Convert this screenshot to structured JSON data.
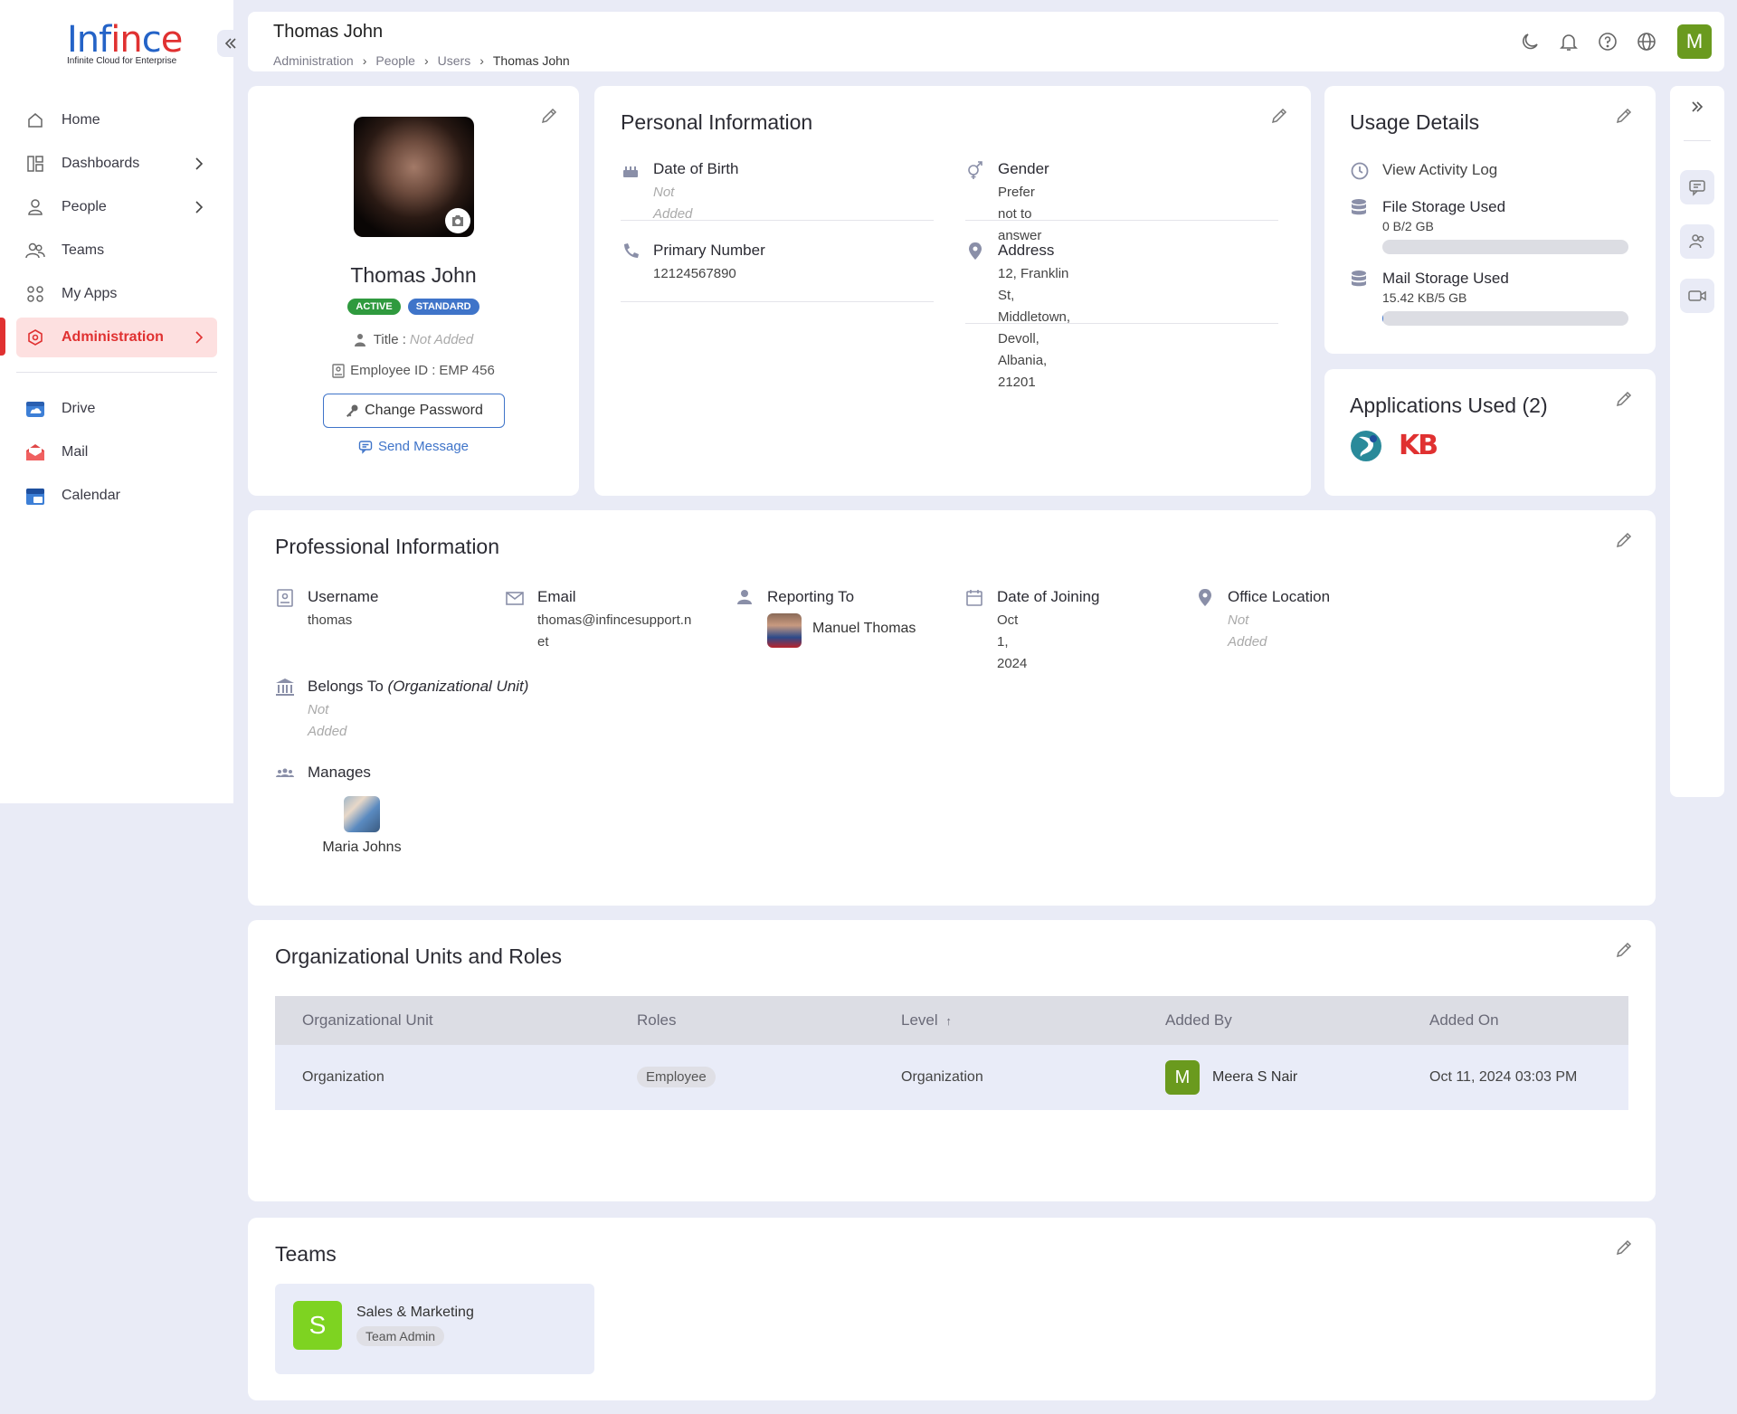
{
  "app": {
    "logo_text_blue": "Inf",
    "logo_text_red": "in",
    "logo_text_blue2": "c",
    "logo_text_red2": "e",
    "logo_tagline": "Infinite Cloud for Enterprise"
  },
  "sidebar": {
    "items": [
      {
        "label": "Home",
        "icon": "home-icon"
      },
      {
        "label": "Dashboards",
        "icon": "dashboard-icon"
      },
      {
        "label": "People",
        "icon": "person-icon"
      },
      {
        "label": "Teams",
        "icon": "teams-icon"
      },
      {
        "label": "My Apps",
        "icon": "apps-icon"
      },
      {
        "label": "Administration",
        "icon": "admin-icon"
      }
    ],
    "apps": [
      {
        "label": "Drive",
        "icon": "drive-icon"
      },
      {
        "label": "Mail",
        "icon": "mail-icon"
      },
      {
        "label": "Calendar",
        "icon": "calendar-icon"
      }
    ]
  },
  "header": {
    "title": "Thomas John",
    "breadcrumbs": [
      "Administration",
      "People",
      "Users",
      "Thomas John"
    ],
    "user_initial": "M"
  },
  "profile": {
    "name": "Thomas John",
    "status_badge": "ACTIVE",
    "plan_badge": "STANDARD",
    "title_label": "Title :",
    "title_value": "Not Added",
    "employee_id_label": "Employee ID :",
    "employee_id_value": "EMP 456",
    "change_password": "Change Password",
    "send_message": "Send Message"
  },
  "personal": {
    "heading": "Personal Information",
    "dob_label": "Date of Birth",
    "dob_value": "Not Added",
    "gender_label": "Gender",
    "gender_value": "Prefer not to answer",
    "phone_label": "Primary Number",
    "phone_value": "12124567890",
    "address_label": "Address",
    "address_line1": "12, Franklin St, Middletown, Devoll, Albania,",
    "address_line2": "21201"
  },
  "usage": {
    "heading": "Usage Details",
    "activity_log": "View Activity Log",
    "file_label": "File Storage Used",
    "file_value": "0 B/2 GB",
    "file_fraction": 0.0,
    "mail_label": "Mail Storage Used",
    "mail_value": "15.42 KB/5 GB",
    "mail_fraction": 0.003
  },
  "apps": {
    "heading": "Applications Used (2)",
    "kb_text": "KB"
  },
  "professional": {
    "heading": "Professional Information",
    "username_label": "Username",
    "username_value": "thomas",
    "email_label": "Email",
    "email_line1": "thomas@infincesupport.n",
    "email_line2": "et",
    "reporting_label": "Reporting To",
    "reporting_value": "Manuel Thomas",
    "joining_label": "Date of Joining",
    "joining_value": "Oct 1, 2024",
    "office_label": "Office Location",
    "office_value": "Not Added",
    "belongs_label": "Belongs To",
    "belongs_suffix": "(Organizational Unit)",
    "belongs_value": "Not Added",
    "manages_label": "Manages",
    "manages_value": "Maria Johns"
  },
  "org": {
    "heading": "Organizational Units and Roles",
    "columns": [
      "Organizational Unit",
      "Roles",
      "Level",
      "Added By",
      "Added On"
    ],
    "level_sort": "↑",
    "row": {
      "unit": "Organization",
      "role": "Employee",
      "level": "Organization",
      "added_by_initial": "M",
      "added_by": "Meera S Nair",
      "added_on": "Oct 11, 2024 03:03 PM"
    }
  },
  "teams": {
    "heading": "Teams",
    "team_initial": "S",
    "team_name": "Sales & Marketing",
    "team_role": "Team Admin"
  },
  "colors": {
    "accent_red": "#e03131",
    "accent_blue": "#3f74c9",
    "active_green": "#2f9a3e",
    "avatar_green": "#6a9a1e",
    "team_green": "#7ed321"
  }
}
